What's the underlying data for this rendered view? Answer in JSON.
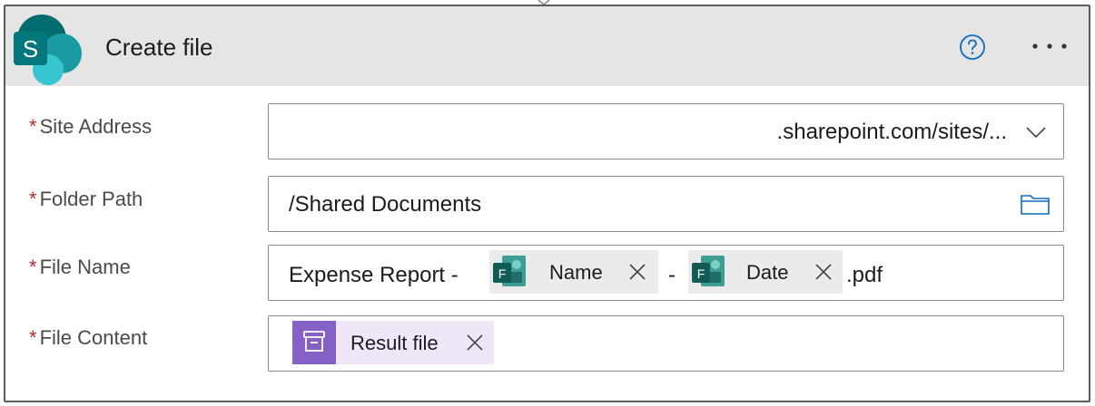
{
  "card": {
    "title": "Create file",
    "help_icon": "question-circle-icon",
    "more_icon": "ellipsis-icon"
  },
  "fields": [
    {
      "label": "Site Address",
      "required_mark": "*",
      "value": ".sharepoint.com/sites/...",
      "control": "dropdown",
      "icon": "chevron-down-icon"
    },
    {
      "label": "Folder Path",
      "required_mark": "*",
      "value": "/Shared Documents",
      "control": "folder-picker",
      "icon": "folder-icon"
    },
    {
      "label": "File Name",
      "required_mark": "*",
      "prefix": "Expense Report -",
      "token1": "Name",
      "separator": "-",
      "token2": "Date",
      "suffix": ".pdf",
      "token_icon": "forms-icon"
    },
    {
      "label": "File Content",
      "required_mark": "*",
      "token": "Result file",
      "token_icon": "archive-icon"
    }
  ],
  "colors": {
    "header_bg": "#e5e5e5",
    "required": "#c4262e",
    "accent_blue": "#0f6cbd",
    "forms_teal": "#2f8c84",
    "purple": "#8661c5"
  }
}
